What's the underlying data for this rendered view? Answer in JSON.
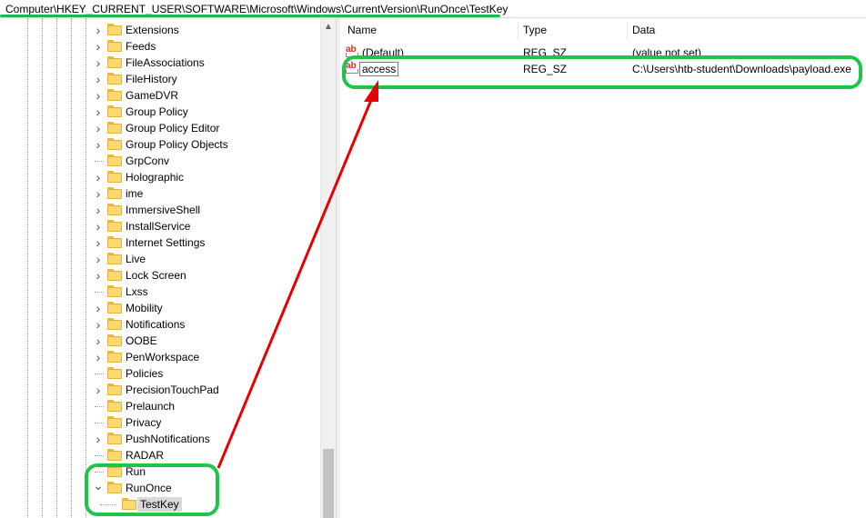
{
  "address_bar": {
    "path": "Computer\\HKEY_CURRENT_USER\\SOFTWARE\\Microsoft\\Windows\\CurrentVersion\\RunOnce\\TestKey"
  },
  "tree": {
    "items": [
      {
        "label": "Extensions",
        "expandable": true
      },
      {
        "label": "Feeds",
        "expandable": true
      },
      {
        "label": "FileAssociations",
        "expandable": true
      },
      {
        "label": "FileHistory",
        "expandable": true
      },
      {
        "label": "GameDVR",
        "expandable": true
      },
      {
        "label": "Group Policy",
        "expandable": true
      },
      {
        "label": "Group Policy Editor",
        "expandable": true
      },
      {
        "label": "Group Policy Objects",
        "expandable": true
      },
      {
        "label": "GrpConv",
        "expandable": false
      },
      {
        "label": "Holographic",
        "expandable": true
      },
      {
        "label": "ime",
        "expandable": true
      },
      {
        "label": "ImmersiveShell",
        "expandable": true
      },
      {
        "label": "InstallService",
        "expandable": true
      },
      {
        "label": "Internet Settings",
        "expandable": true
      },
      {
        "label": "Live",
        "expandable": true
      },
      {
        "label": "Lock Screen",
        "expandable": true
      },
      {
        "label": "Lxss",
        "expandable": false
      },
      {
        "label": "Mobility",
        "expandable": true
      },
      {
        "label": "Notifications",
        "expandable": true
      },
      {
        "label": "OOBE",
        "expandable": true
      },
      {
        "label": "PenWorkspace",
        "expandable": true
      },
      {
        "label": "Policies",
        "expandable": false
      },
      {
        "label": "PrecisionTouchPad",
        "expandable": true
      },
      {
        "label": "Prelaunch",
        "expandable": false
      },
      {
        "label": "Privacy",
        "expandable": false
      },
      {
        "label": "PushNotifications",
        "expandable": true
      },
      {
        "label": "RADAR",
        "expandable": false
      },
      {
        "label": "Run",
        "expandable": false
      },
      {
        "label": "RunOnce",
        "expandable": true,
        "expanded": true
      },
      {
        "label": "TestKey",
        "expandable": false,
        "child": true,
        "selected": true
      }
    ]
  },
  "values_list": {
    "columns": {
      "name": "Name",
      "type": "Type",
      "data": "Data"
    },
    "rows": [
      {
        "name": "(Default)",
        "type": "REG_SZ",
        "data": "(value not set)"
      },
      {
        "name": "access",
        "type": "REG_SZ",
        "data": "C:\\Users\\htb-student\\Downloads\\payload.exe",
        "editing": true
      }
    ]
  },
  "icons": {
    "string_value": "ab-icon",
    "folder": "folder-icon",
    "expander_collapsed": "chevron-right-icon",
    "expander_expanded": "chevron-down-icon"
  },
  "colors": {
    "highlight": "#1fc44a",
    "arrow": "#e60000",
    "folder": "#ffd86e",
    "selected_bg": "#d9d9d9"
  }
}
